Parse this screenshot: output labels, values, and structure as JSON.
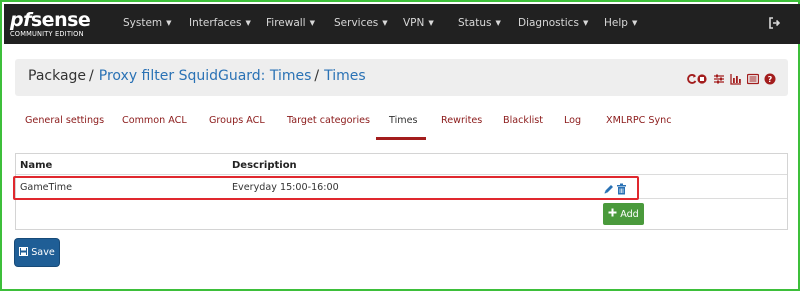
{
  "brand": {
    "prefix": "pf",
    "name": "sense",
    "edition": "COMMUNITY EDITION"
  },
  "nav": [
    {
      "label": "System"
    },
    {
      "label": "Interfaces"
    },
    {
      "label": "Firewall"
    },
    {
      "label": "Services"
    },
    {
      "label": "VPN"
    },
    {
      "label": "Status"
    },
    {
      "label": "Diagnostics"
    },
    {
      "label": "Help"
    }
  ],
  "breadcrumb": {
    "root": "Package",
    "item1": "Proxy filter SquidGuard: Times",
    "item2": "Times",
    "separator": "/"
  },
  "tabs": [
    {
      "label": "General settings"
    },
    {
      "label": "Common ACL"
    },
    {
      "label": "Groups ACL"
    },
    {
      "label": "Target categories"
    },
    {
      "label": "Times",
      "active": true
    },
    {
      "label": "Rewrites"
    },
    {
      "label": "Blacklist"
    },
    {
      "label": "Log"
    },
    {
      "label": "XMLRPC Sync"
    }
  ],
  "table": {
    "headers": {
      "name": "Name",
      "description": "Description"
    },
    "rows": [
      {
        "name": "GameTime",
        "description": "Everyday 15:00-16:00"
      }
    ]
  },
  "buttons": {
    "add": "Add",
    "save": "Save"
  },
  "colors": {
    "navbar": "#212121",
    "accent_tab": "#a31d1d",
    "link": "#2a72b5",
    "add_green": "#4a9a3c",
    "save_blue": "#1f5e96",
    "highlight_red": "#e0282e",
    "frame_green": "#3dbf3a"
  },
  "icons": {
    "logout": "sign-out-icon",
    "crumb": [
      "reload-stop-icon",
      "sliders-icon",
      "bar-chart-icon",
      "list-icon",
      "help-icon"
    ],
    "row": [
      "pencil-icon",
      "trash-icon"
    ],
    "add": "plus-icon",
    "save": "save-icon"
  }
}
